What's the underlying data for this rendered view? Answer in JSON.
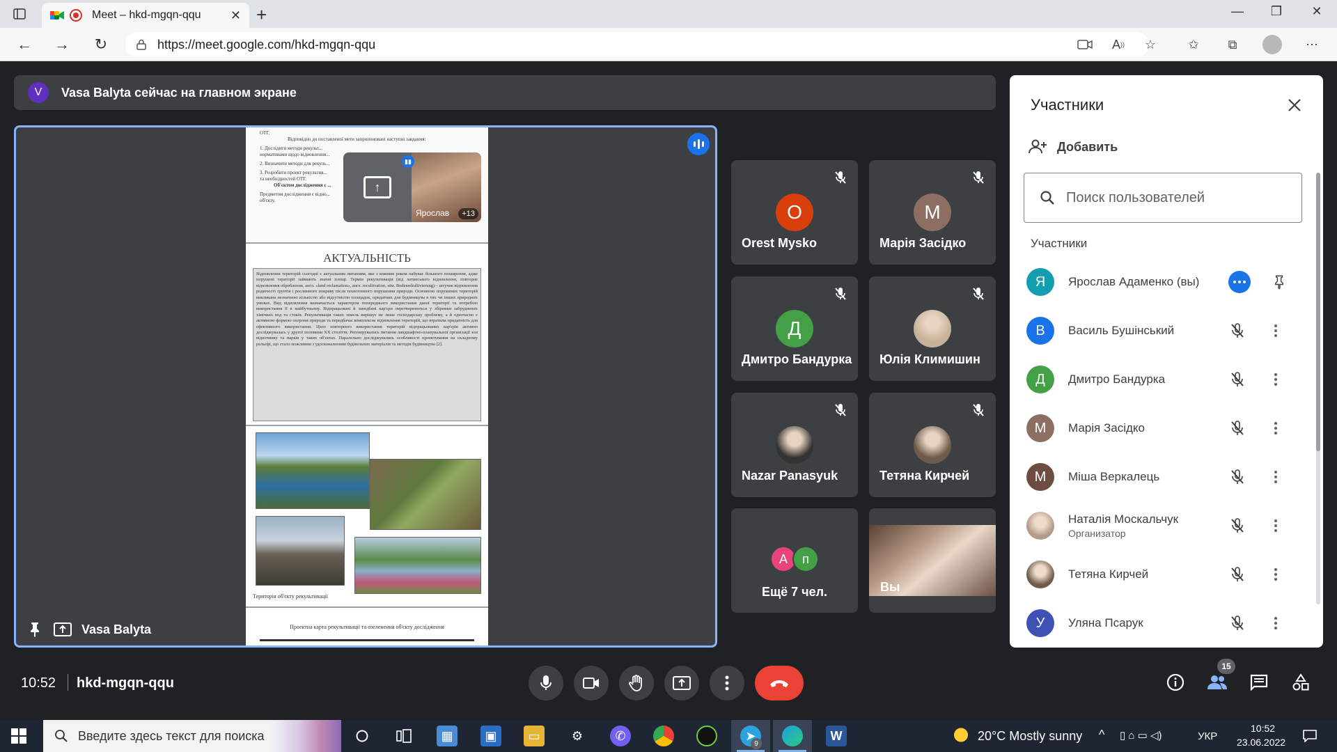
{
  "browser": {
    "tab_title": "Meet – hkd-mgqn-qqu",
    "url": "https://meet.google.com/hkd-mgqn-qqu"
  },
  "banner": {
    "avatar_letter": "V",
    "text": "Vasa Balyta сейчас на главном экране"
  },
  "stage": {
    "presenter_name": "Vasa Balyta",
    "slide": {
      "top_lines": [
        "ОТГ.",
        "Відповідно до поставленої мети запропоновані наступні завдання:",
        "1. Дослідити методи рекульт...",
        "нормативами щодо відновлення...",
        "2. Визначити методи для рекуль...",
        "3. Розробити проект рекультив...",
        "та необхідностей ОТГ.",
        "Об'єктом дослідження є ...",
        "Предметом дослідження є відно...",
        "об'єкту."
      ],
      "heading": "АКТУАЛЬНІСТЬ",
      "body": "Відновлення територій сьогодні є актуальним питанням, яке з кожним роком набуває більшого поширення, адже порушені території займають значні площі. Термін рекультивація (від латинського відновлення, повторне відновлення оброблення, англ. «land reclamation», англ. recultivation, нім. Bodenrekultivierung) – штучне відновлення родючості ґрунтів і рослинного покриву після техногенного порушення природи. Основною порушених територій викликана незначною кількістю або відсутністю площадок, придатних для будівництва в тих чи інших природних умовах. Вид відновлення визначається характером попереднього використання даної території та потребою використання її в майбутньому. Відпрацьовані й занедбані кар'єри перетворюються у збірники забруднених хімічних вод та стоків. Рекультивація таких земель вирішує не лише господарську проблему, а й одночасно є активною формою охорони природи та передбачає комплексне відновлення територій, що втратили придатність для ефективного використання. Цією повторного використання територій відпрацьованих кар'єрів активно досліджувалась у другої половини XX століття. Регенерувались питання ландшафтно-планувальної організації зон відпочинку та парків у таких об'єктах. Паралельно досліджувались особливості проектування на складному рельєфі, що стало можливим з удосконаленням будівельних матеріалів та методів будівництва [2].",
      "photo_caption": "Територія об'єкту рекультивації",
      "footer": "Проектна карта рекультивації та озеленення об'єкту дослідження"
    },
    "self_preview": {
      "name": "Ярослав",
      "more_count": "+13"
    }
  },
  "tiles": [
    {
      "name": "Orest Mysko",
      "letter": "O",
      "color": "#d93f0b",
      "muted": true
    },
    {
      "name": "Марія Засідко",
      "letter": "M",
      "color": "#8d6e63",
      "muted": true
    },
    {
      "name": "Дмитро Бандурка",
      "letter": "Д",
      "color": "#43a047",
      "muted": true
    },
    {
      "name": "Юлія Климишин",
      "letter": "",
      "color": "#c7b299",
      "muted": true,
      "photo": true
    },
    {
      "name": "Nazar Panasyuk",
      "letter": "",
      "color": "#333333",
      "muted": true,
      "photo": true
    },
    {
      "name": "Тетяна Кирчей",
      "letter": "",
      "color": "#6d5b4b",
      "muted": true,
      "photo": true
    }
  ],
  "more_tile": {
    "av1": "A",
    "av1_color": "#e8437a",
    "av2": "п",
    "av2_color": "#43a047",
    "label": "Ещё 7 чел."
  },
  "you_tile": {
    "label": "Вы"
  },
  "bottom_bar": {
    "time": "10:52",
    "meeting_code": "hkd-mgqn-qqu",
    "participants_count": "15"
  },
  "panel": {
    "title": "Участники",
    "add_label": "Добавить",
    "search_placeholder": "Поиск пользователей",
    "section_label": "Участники",
    "people": [
      {
        "name": "Ярослав Адаменко (вы)",
        "letter": "Я",
        "color": "#129eaf",
        "role": "",
        "self": true
      },
      {
        "name": "Василь Бушінський",
        "letter": "В",
        "color": "#1a73e8",
        "role": ""
      },
      {
        "name": "Дмитро Бандурка",
        "letter": "Д",
        "color": "#43a047",
        "role": ""
      },
      {
        "name": "Марія Засідко",
        "letter": "М",
        "color": "#8d6e63",
        "role": ""
      },
      {
        "name": "Міша Веркалець",
        "letter": "М",
        "color": "#6d4c41",
        "role": ""
      },
      {
        "name": "Наталія Москальчук",
        "letter": "",
        "color": "#b49a88",
        "role": "Организатор",
        "photo": true
      },
      {
        "name": "Тетяна Кирчей",
        "letter": "",
        "color": "#6d5b4b",
        "role": "",
        "photo": true
      },
      {
        "name": "Уляна Псарук",
        "letter": "У",
        "color": "#3f51b5",
        "role": ""
      }
    ]
  },
  "taskbar": {
    "search_placeholder": "Введите здесь текст для поиска",
    "weather": "20°C  Mostly sunny",
    "lang": "УКР",
    "time": "10:52",
    "date": "23.06.2022",
    "telegram_badge": "9"
  }
}
